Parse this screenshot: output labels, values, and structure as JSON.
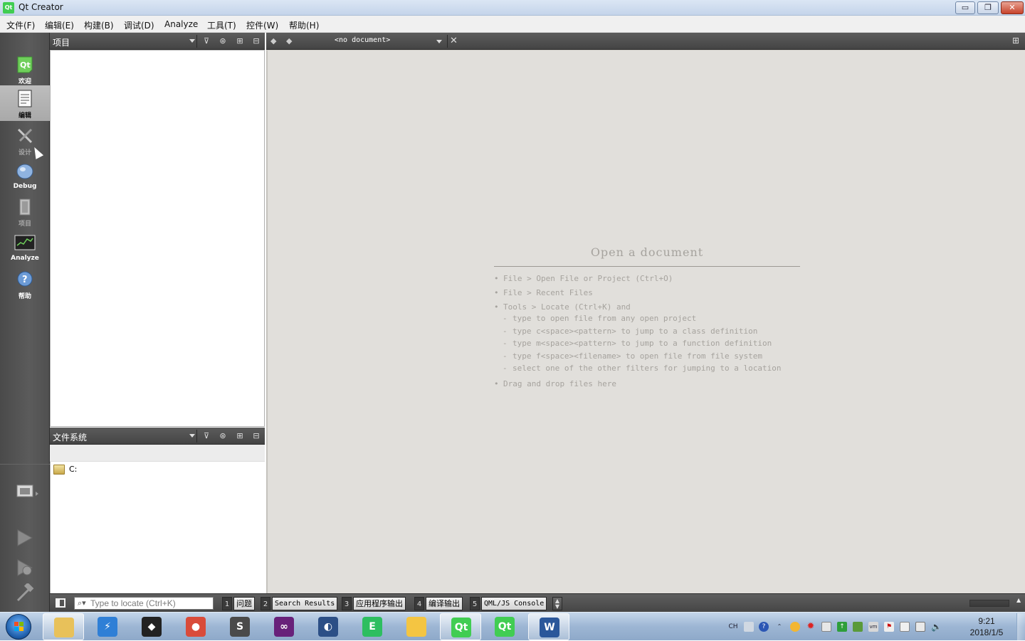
{
  "window": {
    "title": "Qt Creator",
    "min_label": "▭",
    "max_label": "❐",
    "close_label": "✕"
  },
  "menu": [
    "文件(F)",
    "编辑(E)",
    "构建(B)",
    "调试(D)",
    "Analyze",
    "工具(T)",
    "控件(W)",
    "帮助(H)"
  ],
  "modes": [
    {
      "label": "欢迎",
      "icon": "qt-logo-icon",
      "state": "normal"
    },
    {
      "label": "编辑",
      "icon": "document-edit-icon",
      "state": "active"
    },
    {
      "label": "设计",
      "icon": "design-tools-icon",
      "state": "dim"
    },
    {
      "label": "Debug",
      "icon": "debug-bug-icon",
      "state": "normal"
    },
    {
      "label": "项目",
      "icon": "project-wrench-icon",
      "state": "dim"
    },
    {
      "label": "Analyze",
      "icon": "analyze-monitor-icon",
      "state": "normal"
    },
    {
      "label": "帮助",
      "icon": "help-question-icon",
      "state": "normal"
    }
  ],
  "project_pane": {
    "title": "项目"
  },
  "fs_pane": {
    "title": "文件系统",
    "drive": "C:"
  },
  "editor": {
    "document": "<no document>",
    "welcome": {
      "heading": "Open a document",
      "items": [
        {
          "kind": "main",
          "text": "File > Open File or Project (Ctrl+O)"
        },
        {
          "kind": "main",
          "text": "File > Recent Files"
        },
        {
          "kind": "main",
          "text": "Tools > Locate (Ctrl+K) and"
        },
        {
          "kind": "sub",
          "text": "type to open file from any open project"
        },
        {
          "kind": "sub",
          "text": "type c<space><pattern> to jump to a class definition"
        },
        {
          "kind": "sub",
          "text": "type m<space><pattern> to jump to a function definition"
        },
        {
          "kind": "sub",
          "text": "type f<space><filename> to open file from file system"
        },
        {
          "kind": "sub",
          "text": "select one of the other filters for jumping to a location"
        },
        {
          "kind": "main",
          "text": "Drag and drop files here"
        }
      ]
    }
  },
  "locator": {
    "placeholder": "Type to locate (Ctrl+K)"
  },
  "output_tabs": [
    {
      "num": "1",
      "label": "问题"
    },
    {
      "num": "2",
      "label": "Search Results"
    },
    {
      "num": "3",
      "label": "应用程序输出"
    },
    {
      "num": "4",
      "label": "编译输出"
    },
    {
      "num": "5",
      "label": "QML/JS Console"
    }
  ],
  "taskbar": {
    "apps": [
      {
        "name": "explorer",
        "label": "",
        "color": "#e8c15a",
        "active": true
      },
      {
        "name": "thunder",
        "label": "⚡",
        "color": "#2f7fd6",
        "active": false
      },
      {
        "name": "unity",
        "label": "◆",
        "color": "#222222",
        "active": false
      },
      {
        "name": "chrome",
        "label": "●",
        "color": "#d94b3a",
        "active": false
      },
      {
        "name": "sublime",
        "label": "S",
        "color": "#4a4a4a",
        "active": false
      },
      {
        "name": "visual-studio",
        "label": "∞",
        "color": "#68217a",
        "active": false
      },
      {
        "name": "eclipse",
        "label": "◐",
        "color": "#2c4f86",
        "active": false
      },
      {
        "name": "evernote",
        "label": "E",
        "color": "#2dbe60",
        "active": false
      },
      {
        "name": "folder-app",
        "label": "",
        "color": "#f4c542",
        "active": false
      },
      {
        "name": "qt-creator",
        "label": "Qt",
        "color": "#41cd52",
        "active": true
      },
      {
        "name": "qt-designer",
        "label": "Qt",
        "color": "#41cd52",
        "active": false
      },
      {
        "name": "word",
        "label": "W",
        "color": "#2b579a",
        "active": true
      }
    ],
    "lang": "CH",
    "time": "9:21",
    "date": "2018/1/5"
  }
}
